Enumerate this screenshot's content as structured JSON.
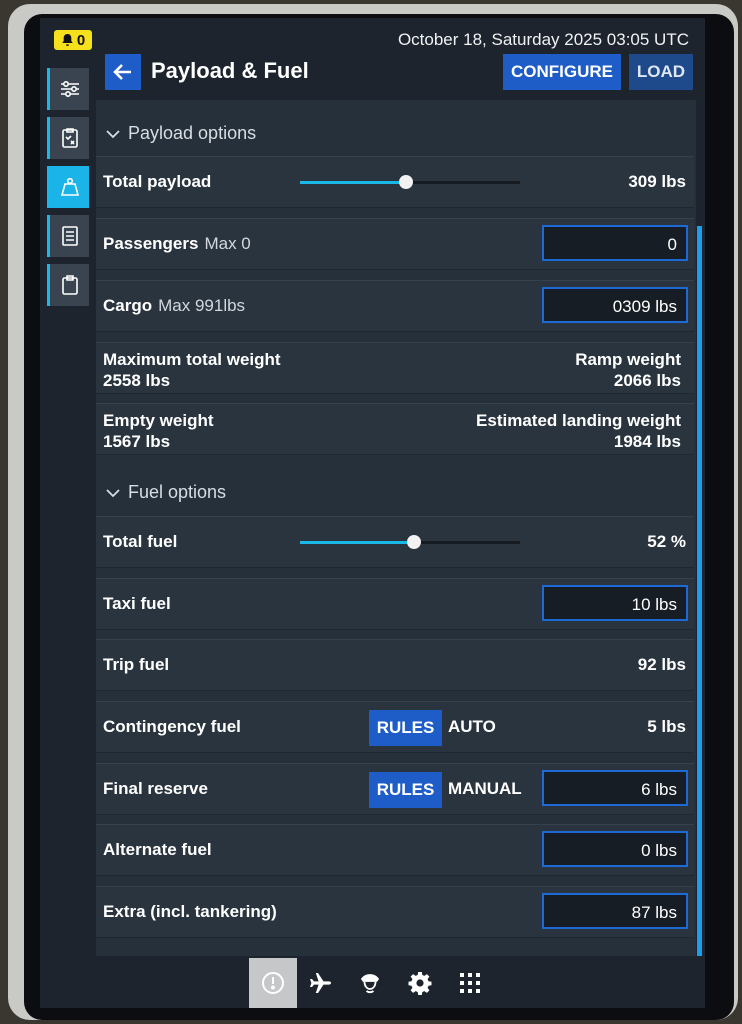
{
  "status": {
    "notification_count": "0",
    "datetime": "October 18, Saturday 2025 03:05 UTC"
  },
  "header": {
    "title": "Payload & Fuel",
    "configure_label": "CONFIGURE",
    "load_label": "LOAD"
  },
  "payload": {
    "section_title": "Payload options",
    "total_payload_label": "Total payload",
    "total_payload_value": "309 lbs",
    "total_payload_fraction": 0.48,
    "passengers_label": "Passengers",
    "passengers_max": "Max 0",
    "passengers_value": "0",
    "cargo_label": "Cargo",
    "cargo_max": "Max 991lbs",
    "cargo_value": "0309 lbs",
    "max_total_weight_label": "Maximum total weight",
    "max_total_weight_value": "2558 lbs",
    "ramp_weight_label": "Ramp weight",
    "ramp_weight_value": "2066 lbs",
    "empty_weight_label": "Empty weight",
    "empty_weight_value": "1567 lbs",
    "est_landing_weight_label": "Estimated landing weight",
    "est_landing_weight_value": "1984 lbs"
  },
  "fuel": {
    "section_title": "Fuel options",
    "total_fuel_label": "Total fuel",
    "total_fuel_value": "52 %",
    "total_fuel_fraction": 0.52,
    "taxi_label": "Taxi fuel",
    "taxi_value": "10 lbs",
    "trip_label": "Trip fuel",
    "trip_value": "92 lbs",
    "contingency_label": "Contingency fuel",
    "contingency_rules": "RULES",
    "contingency_mode": "AUTO",
    "contingency_value": "5 lbs",
    "final_reserve_label": "Final reserve",
    "final_reserve_rules": "RULES",
    "final_reserve_mode": "MANUAL",
    "final_reserve_value": "6 lbs",
    "alternate_label": "Alternate fuel",
    "alternate_value": "0 lbs",
    "extra_label": "Extra (incl. tankering)",
    "extra_value": "87 lbs"
  },
  "icons": {
    "side_nav": [
      "sliders-icon",
      "checklist-icon",
      "weight-icon",
      "document-icon",
      "clipboard-icon"
    ],
    "bottom_bar": [
      "compass-icon",
      "airplane-icon",
      "pilot-icon",
      "gear-icon",
      "apps-grid-icon"
    ]
  },
  "colors": {
    "accent": "#19b8e6",
    "button": "#1e5cc8",
    "badge": "#f5e11c"
  }
}
